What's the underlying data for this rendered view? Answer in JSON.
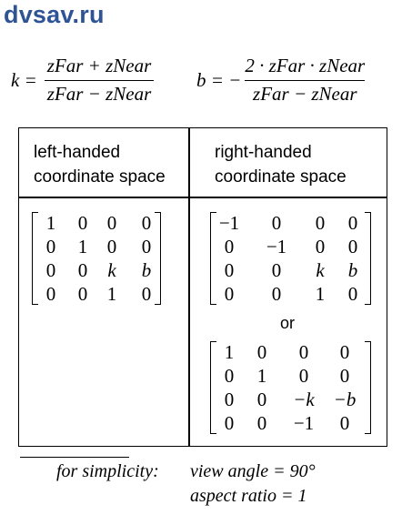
{
  "logo": {
    "text": "dvsav.ru"
  },
  "formulas": {
    "k": {
      "lhs": "k =",
      "numerator": "zFar + zNear",
      "denominator": "zFar − zNear"
    },
    "b": {
      "lhs": "b = −",
      "numerator": "2 · zFar · zNear",
      "denominator": "zFar − zNear"
    }
  },
  "table": {
    "headers": {
      "left": [
        "left-handed",
        "coordinate space"
      ],
      "right": [
        "right-handed",
        "coordinate space"
      ]
    },
    "or_text": "or",
    "left_matrix": [
      [
        "1",
        "0",
        "0",
        "0"
      ],
      [
        "0",
        "1",
        "0",
        "0"
      ],
      [
        "0",
        "0",
        "k",
        "b"
      ],
      [
        "0",
        "0",
        "1",
        "0"
      ]
    ],
    "right_matrix_1": [
      [
        "−1",
        "0",
        "0",
        "0"
      ],
      [
        "0",
        "−1",
        "0",
        "0"
      ],
      [
        "0",
        "0",
        "k",
        "b"
      ],
      [
        "0",
        "0",
        "1",
        "0"
      ]
    ],
    "right_matrix_2": [
      [
        "1",
        "0",
        "0",
        "0"
      ],
      [
        "0",
        "1",
        "0",
        "0"
      ],
      [
        "0",
        "0",
        "−k",
        "−b"
      ],
      [
        "0",
        "0",
        "−1",
        "0"
      ]
    ]
  },
  "notes": {
    "prefix": "for simplicity:",
    "view_angle": "view angle = 90°",
    "aspect_ratio": "aspect ratio = 1"
  }
}
